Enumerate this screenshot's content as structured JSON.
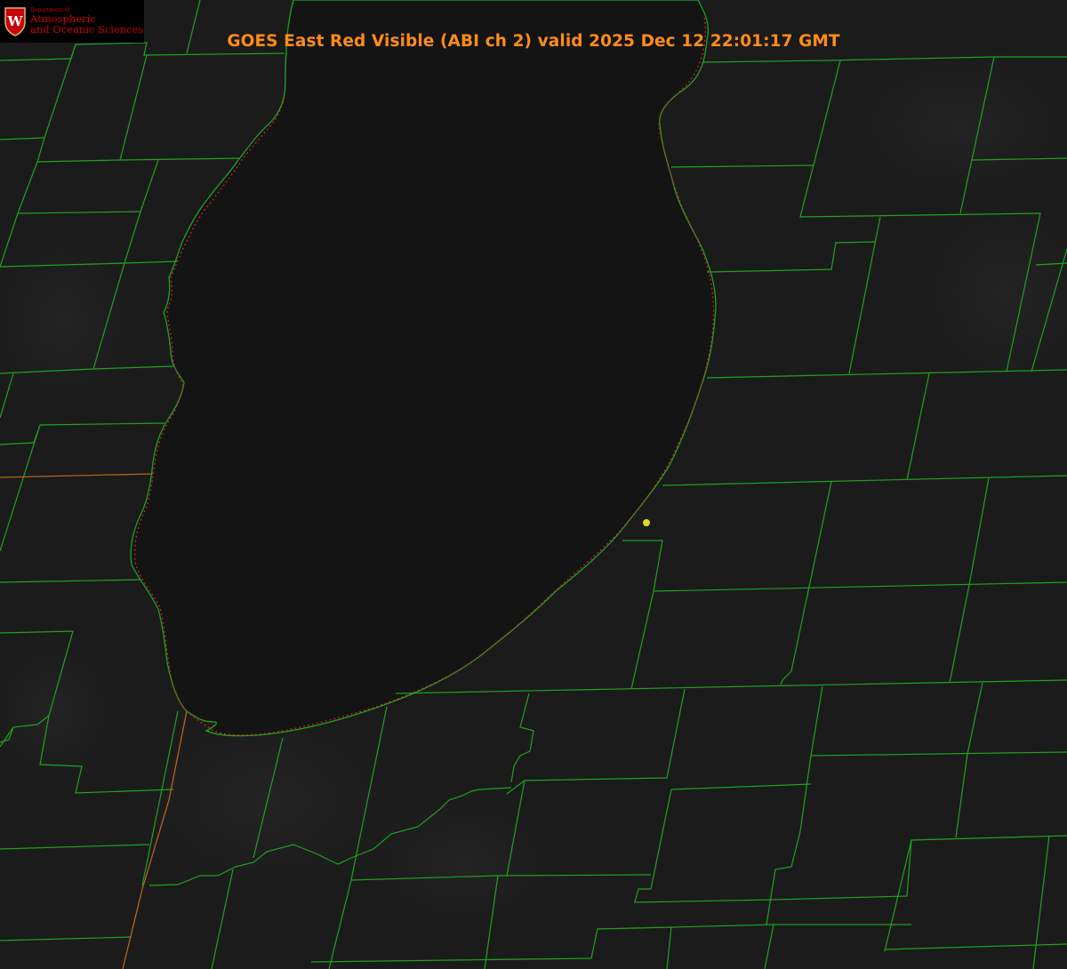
{
  "title": "GOES East Red Visible (ABI ch 2) valid 2025 Dec 12 22:01:17 GMT",
  "logo": {
    "dept_label": "Department of",
    "line1": "Atmospheric",
    "line2": "and Oceanic Sciences",
    "crest_letter": "W",
    "crest_color": "#c5050c"
  },
  "colors": {
    "background": "#1a1a1a",
    "lake": "#141414",
    "county_lines": "#1fa31f",
    "coastline_dots": "#e02020",
    "state_line": "#b5651d",
    "title": "#ff8c1a",
    "station_marker": "#e6d52a"
  },
  "map": {
    "product": "GOES East Red Visible (ABI ch 2)",
    "layers": [
      "satellite-visible",
      "county-boundaries",
      "lake-shoreline",
      "state-boundary",
      "station-marker"
    ],
    "icons": [
      "uw-crest-icon",
      "station-marker-icon"
    ]
  }
}
